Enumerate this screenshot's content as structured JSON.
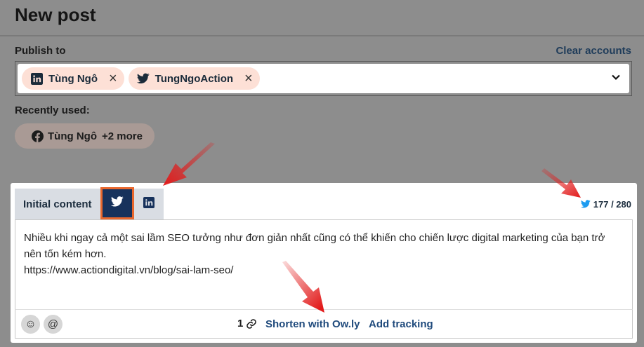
{
  "header": {
    "title": "New post"
  },
  "publish": {
    "label": "Publish to",
    "clear_label": "Clear accounts",
    "accounts": [
      {
        "network": "linkedin",
        "name": "Tùng Ngô"
      },
      {
        "network": "twitter",
        "name": "TungNgoAction"
      }
    ]
  },
  "recent": {
    "label": "Recently used:",
    "chip_name": "Tùng Ngô",
    "chip_more": "+2 more"
  },
  "editor": {
    "tab_initial": "Initial content",
    "counter": "177 / 280",
    "text_line1": "Nhiều khi ngay cả một sai lầm SEO tưởng như đơn giản nhất cũng có thể khiến cho chiến lược digital marketing của bạn trở nên tốn kém hơn.",
    "text_line2": "https://www.actiondigital.vn/blog/sai-lam-seo/",
    "emoji_symbol": "☺",
    "mention_symbol": "@",
    "link_count": "1",
    "shorten_label": "Shorten with Ow.ly",
    "tracking_label": "Add tracking"
  },
  "colors": {
    "overlay": "#8d8d8d",
    "chip_bg": "#fde0d6",
    "twitter_tab": "#17325c",
    "highlight_border": "#e8672d",
    "link": "#1f4a7c",
    "twitter_blue": "#1d9bf0",
    "arrow_red": "#e21b1b"
  },
  "icons": [
    "linkedin-icon",
    "twitter-icon",
    "facebook-icon",
    "close-icon",
    "chevron-down-icon",
    "emoji-icon",
    "mention-icon",
    "link-icon"
  ]
}
